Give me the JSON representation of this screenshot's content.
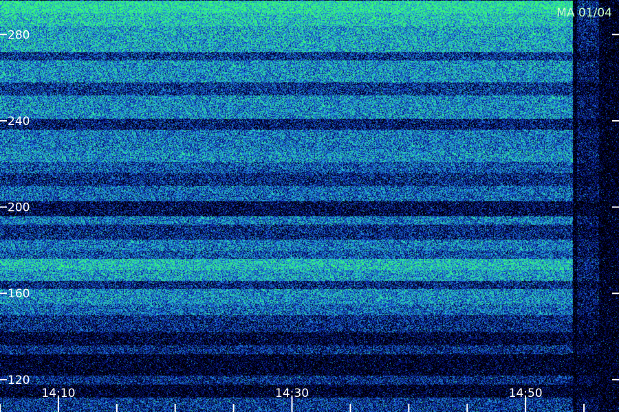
{
  "station_label": "MA 01/04",
  "chart_data": {
    "type": "heatmap",
    "title": "",
    "xlabel": "",
    "ylabel": "",
    "y_ticks": [
      {
        "value": 120,
        "label": "120"
      },
      {
        "value": 160,
        "label": "160"
      },
      {
        "value": 200,
        "label": "200"
      },
      {
        "value": 240,
        "label": "240"
      },
      {
        "value": 280,
        "label": "280"
      }
    ],
    "ylim": [
      105,
      296
    ],
    "x_ticks": [
      {
        "value": "14:10",
        "label": "14:10"
      },
      {
        "value": "14:30",
        "label": "14:30"
      },
      {
        "value": "14:50",
        "label": "14:50"
      }
    ],
    "x_minor_ticks": [
      "14:05",
      "14:15",
      "14:20",
      "14:25",
      "14:35",
      "14:40",
      "14:45",
      "14:55"
    ],
    "xlim": [
      "14:05",
      "14:58"
    ],
    "colormap": [
      "#000000",
      "#00003c",
      "#0a1fa0",
      "#1e5cdc",
      "#1fa6d8",
      "#2fe0b0",
      "#3cff6a"
    ],
    "data_end_time": "14:54",
    "bands": [
      {
        "from": 105,
        "to": 112,
        "intensity": 0.35
      },
      {
        "from": 112,
        "to": 118,
        "intensity": 0.05
      },
      {
        "from": 118,
        "to": 122,
        "intensity": 0.3
      },
      {
        "from": 122,
        "to": 132,
        "intensity": 0.05
      },
      {
        "from": 132,
        "to": 136,
        "intensity": 0.3
      },
      {
        "from": 136,
        "to": 142,
        "intensity": 0.1
      },
      {
        "from": 142,
        "to": 150,
        "intensity": 0.3
      },
      {
        "from": 150,
        "to": 155,
        "intensity": 0.5
      },
      {
        "from": 155,
        "to": 162,
        "intensity": 0.6
      },
      {
        "from": 162,
        "to": 166,
        "intensity": 0.3
      },
      {
        "from": 166,
        "to": 171,
        "intensity": 0.65
      },
      {
        "from": 171,
        "to": 176,
        "intensity": 0.75
      },
      {
        "from": 176,
        "to": 180,
        "intensity": 0.45
      },
      {
        "from": 180,
        "to": 185,
        "intensity": 0.55
      },
      {
        "from": 185,
        "to": 192,
        "intensity": 0.3
      },
      {
        "from": 192,
        "to": 196,
        "intensity": 0.55
      },
      {
        "from": 196,
        "to": 203,
        "intensity": 0.15
      },
      {
        "from": 203,
        "to": 210,
        "intensity": 0.5
      },
      {
        "from": 210,
        "to": 216,
        "intensity": 0.3
      },
      {
        "from": 216,
        "to": 221,
        "intensity": 0.45
      },
      {
        "from": 221,
        "to": 226,
        "intensity": 0.6
      },
      {
        "from": 226,
        "to": 236,
        "intensity": 0.55
      },
      {
        "from": 236,
        "to": 241,
        "intensity": 0.25
      },
      {
        "from": 241,
        "to": 252,
        "intensity": 0.6
      },
      {
        "from": 252,
        "to": 258,
        "intensity": 0.35
      },
      {
        "from": 258,
        "to": 268,
        "intensity": 0.62
      },
      {
        "from": 268,
        "to": 272,
        "intensity": 0.35
      },
      {
        "from": 272,
        "to": 284,
        "intensity": 0.68
      },
      {
        "from": 284,
        "to": 290,
        "intensity": 0.78
      },
      {
        "from": 290,
        "to": 296,
        "intensity": 0.88
      }
    ]
  }
}
